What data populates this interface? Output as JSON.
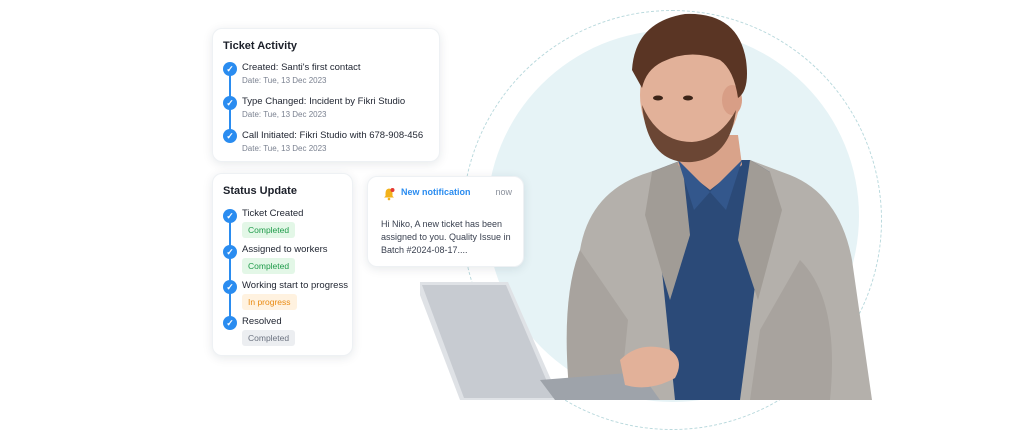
{
  "ticket_activity": {
    "title": "Ticket Activity",
    "items": [
      {
        "label": "Created: Santi's first contact",
        "date": "Date: Tue, 13 Dec 2023"
      },
      {
        "label": "Type Changed: Incident by Fikri Studio",
        "date": "Date: Tue, 13 Dec 2023"
      },
      {
        "label": "Call Initiated: Fikri Studio with 678-908-456",
        "date": "Date: Tue, 13 Dec 2023"
      }
    ]
  },
  "status_update": {
    "title": "Status Update",
    "items": [
      {
        "label": "Ticket Created",
        "status": "Completed",
        "status_color": "#1f9b4a"
      },
      {
        "label": "Assigned to workers",
        "status": "Completed",
        "status_color": "#1f9b4a"
      },
      {
        "label": "Working start to progress",
        "status": "In progress",
        "status_color": "#e98a12"
      },
      {
        "label": "Resolved",
        "status": "Completed",
        "status_color": "#6c7380"
      }
    ]
  },
  "notification": {
    "title": "New notification",
    "time": "now",
    "message_line1": "Hi Niko, A new ticket has been",
    "message_line2": "assigned to you. Quality Issue in",
    "message_line3": "Batch #2024-08-17....",
    "icon": "bell-icon"
  },
  "colors": {
    "accent": "#2a8cf0",
    "background_circle": "#e6f3f6"
  }
}
